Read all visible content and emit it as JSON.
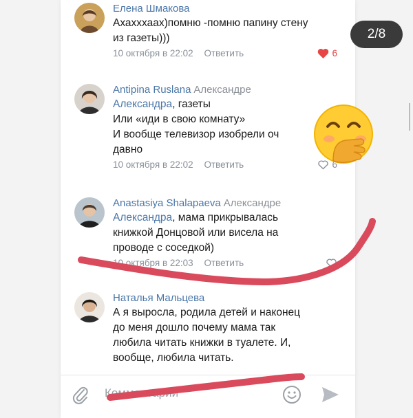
{
  "slide_counter": "2/8",
  "comments": [
    {
      "author": "Елена Шмакова",
      "reply_to": "",
      "mention": "",
      "lines": [
        "Ахахххаах)помню -помню папину стену",
        "из газеты)))"
      ],
      "date": "10 октября в 22:02",
      "reply_label": "Ответить",
      "likes": "6",
      "liked": true
    },
    {
      "author": "Antipina Ruslana",
      "reply_to": "Александре",
      "mention": "Александра",
      "lines": [
        ", газеты",
        "Или «иди в свою комнату»",
        "И вообще телевизор изобрели оч",
        "давно"
      ],
      "date": "10 октября в 22:02",
      "reply_label": "Ответить",
      "likes": "6",
      "liked": false
    },
    {
      "author": "Anastasiya Shalapaeva",
      "reply_to": "Александре",
      "mention": "Александра",
      "lines": [
        ", мама прикрывалась",
        "книжкой Донцовой или висела на",
        "проводе с соседкой)"
      ],
      "date": "10 октября в 22:03",
      "reply_label": "Ответить",
      "likes": "",
      "liked": false
    },
    {
      "author": "Наталья Мальцева",
      "reply_to": "",
      "mention": "",
      "lines": [
        "А я выросла, родила детей и наконец",
        "до меня дошло почему мама так",
        "любила читать книжки в туалете. И,",
        "вообще, любила читать."
      ],
      "date": "",
      "reply_label": "",
      "likes": "",
      "liked": false
    }
  ],
  "composer": {
    "placeholder": "Комментарий"
  },
  "colors": {
    "link": "#4a76a8",
    "meta": "#8a9099",
    "like_active": "#e64646",
    "scribble": "#d94a5c"
  },
  "icons": [
    "attach-icon",
    "smile-icon",
    "send-icon",
    "heart-icon",
    "face-with-hand-over-mouth-emoji"
  ]
}
